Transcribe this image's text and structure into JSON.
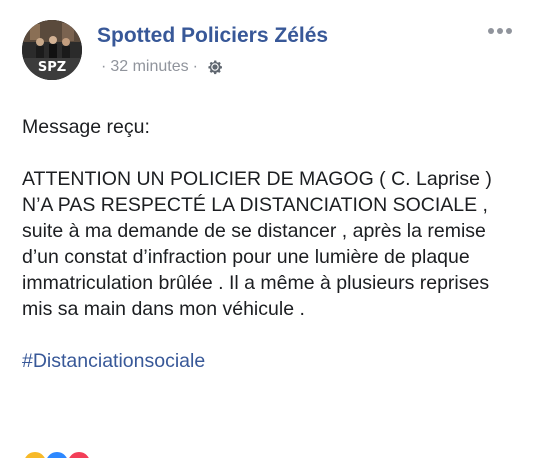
{
  "post": {
    "page_name": "Spotted Policiers Zélés",
    "avatar_text": "SPZ",
    "meta_separator": "·",
    "timestamp": "32 minutes",
    "audience_icon": "gear-icon",
    "more_icon": "three-dots-icon",
    "message_intro": "Message reçu:",
    "message_body": "ATTENTION UN POLICIER DE MAGOG ( C. Laprise ) N’A PAS RESPECTÉ LA DISTANCIATION SOCIALE , suite à ma demande de se distancer , après la remise d’un constat d’infraction pour une lumière de plaque immatriculation brûlée . Il a même à plusieurs reprises mis sa main dans mon véhicule .",
    "hashtag": "#Distanciationsociale"
  },
  "colors": {
    "link": "#385898",
    "meta": "#90949c",
    "text": "#1c1e21",
    "reaction_like": "#f7b928",
    "reaction_second": "#2d88ff",
    "reaction_third": "#f33e58"
  }
}
